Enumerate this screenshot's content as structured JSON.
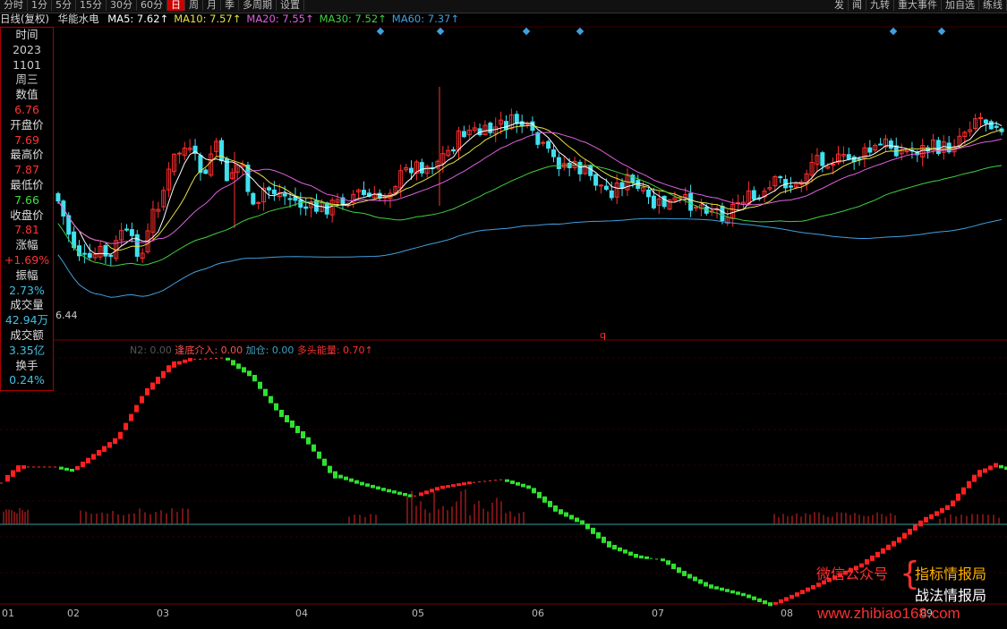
{
  "toolbar": {
    "items": [
      "分时",
      "1分",
      "5分",
      "15分",
      "30分",
      "60分",
      "日",
      "周",
      "月",
      "季",
      "多周期",
      "设置"
    ],
    "active": "日",
    "right_items": [
      "发",
      "闻",
      "九转",
      "重大事件",
      "加自选",
      "练线"
    ]
  },
  "header": {
    "period": "日线(复权)",
    "stock": "华能水电",
    "ma": [
      {
        "label": "MA5: 7.62↑",
        "color": "#ffffff"
      },
      {
        "label": "MA10: 7.57↑",
        "color": "#e8e040"
      },
      {
        "label": "MA20: 7.55↑",
        "color": "#e060e0"
      },
      {
        "label": "MA30: 7.52↑",
        "color": "#40d040"
      },
      {
        "label": "MA60: 7.37↑",
        "color": "#40a0e0"
      }
    ]
  },
  "info_panel": {
    "rows": [
      {
        "label": "时间",
        "color": "#dddddd"
      },
      {
        "label": "2023",
        "color": "#cccccc"
      },
      {
        "label": "1101",
        "color": "#cccccc"
      },
      {
        "label": "周三",
        "color": "#cccccc"
      },
      {
        "label": "数值",
        "color": "#dddddd"
      },
      {
        "label": "6.76",
        "color": "#ff3333"
      },
      {
        "label": "开盘价",
        "color": "#dddddd"
      },
      {
        "label": "7.69",
        "color": "#ff3333"
      },
      {
        "label": "最高价",
        "color": "#dddddd"
      },
      {
        "label": "7.87",
        "color": "#ff3333"
      },
      {
        "label": "最低价",
        "color": "#dddddd"
      },
      {
        "label": "7.66",
        "color": "#40e040"
      },
      {
        "label": "收盘价",
        "color": "#dddddd"
      },
      {
        "label": "7.81",
        "color": "#ff3333"
      },
      {
        "label": "涨幅",
        "color": "#dddddd"
      },
      {
        "label": "+1.69%",
        "color": "#ff3333"
      },
      {
        "label": "振幅",
        "color": "#dddddd"
      },
      {
        "label": "2.73%",
        "color": "#40c0e0"
      },
      {
        "label": "成交量",
        "color": "#dddddd"
      },
      {
        "label": "42.94万",
        "color": "#40c0e0"
      },
      {
        "label": "成交额",
        "color": "#dddddd"
      },
      {
        "label": "3.35亿",
        "color": "#40c0e0"
      },
      {
        "label": "换手",
        "color": "#dddddd"
      },
      {
        "label": "0.24%",
        "color": "#40c0e0"
      }
    ]
  },
  "price_low_label": "6.44",
  "marker_q": "q",
  "indicator": {
    "items": [
      {
        "label": "N2: 0.00",
        "color": "#555555"
      },
      {
        "label": "逢底介入: 0.00",
        "color": "#ff5050"
      },
      {
        "label": "加仓: 0.00",
        "color": "#40a0c0"
      },
      {
        "label": "多头能量: 0.70↑",
        "color": "#ff3030"
      }
    ]
  },
  "x_axis": [
    "01",
    "02",
    "03",
    "04",
    "05",
    "06",
    "07",
    "08",
    "09"
  ],
  "watermark": {
    "wechat": "微信公众号",
    "line1": "指标情报局",
    "line2": "战法情报局",
    "url": "www.zhibiao168.com"
  },
  "colors": {
    "up": "#ff3030",
    "down": "#40e0f0",
    "accent": "#cc0000"
  },
  "chart_data": {
    "type": "candlestick",
    "ma_series": [
      "MA5",
      "MA10",
      "MA20",
      "MA30",
      "MA60"
    ]
  }
}
